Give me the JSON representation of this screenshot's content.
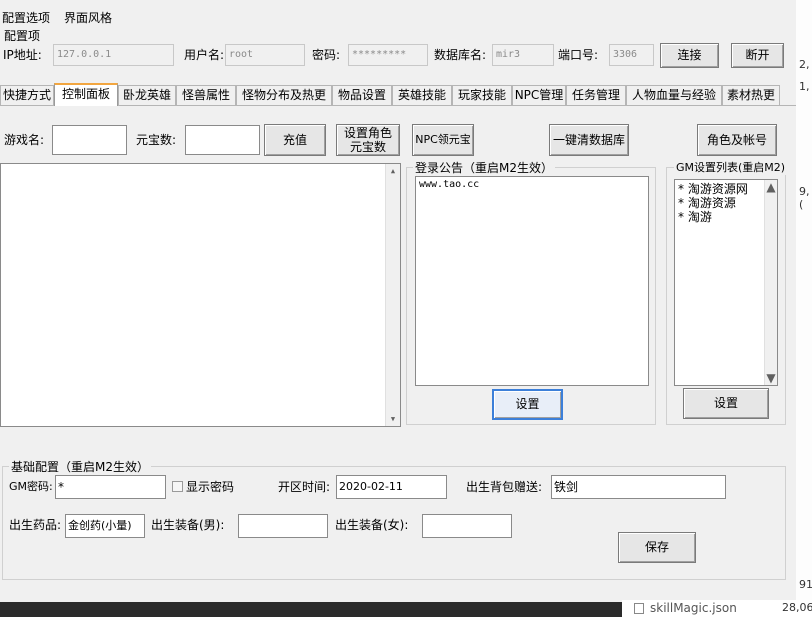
{
  "menu": {
    "config_options": "配置选项",
    "ui_style": "界面风格"
  },
  "config_section": {
    "title": "配置项",
    "ip_label": "IP地址:",
    "ip_value": "127.0.0.1",
    "user_label": "用户名:",
    "user_value": "root",
    "password_label": "密码:",
    "password_value": "*********",
    "db_label": "数据库名:",
    "db_value": "mir3",
    "port_label": "端口号:",
    "port_value": "3306",
    "connect_button": "连接",
    "disconnect_button": "断开"
  },
  "tabs": [
    {
      "label": "快捷方式",
      "active": false
    },
    {
      "label": "控制面板",
      "active": true
    },
    {
      "label": "卧龙英雄",
      "active": false
    },
    {
      "label": "怪兽属性",
      "active": false
    },
    {
      "label": "怪物分布及热更",
      "active": false
    },
    {
      "label": "物品设置",
      "active": false
    },
    {
      "label": "英雄技能",
      "active": false
    },
    {
      "label": "玩家技能",
      "active": false
    },
    {
      "label": "NPC管理",
      "active": false
    },
    {
      "label": "任务管理",
      "active": false
    },
    {
      "label": "人物血量与经验",
      "active": false
    },
    {
      "label": "素材热更",
      "active": false
    }
  ],
  "control_panel": {
    "game_name_label": "游戏名:",
    "game_name_value": "",
    "yuanbao_label": "元宝数:",
    "yuanbao_value": "",
    "recharge_button": "充值",
    "set_role_yuanbao_button": "设置角色元宝数",
    "npc_yuanbao_button": "NPC领元宝",
    "clear_db_button": "一键清数据库",
    "role_account_button": "角色及帐号"
  },
  "login_notice": {
    "title": "登录公告（重启M2生效）",
    "content": "www.tao.cc",
    "set_button": "设置"
  },
  "gm_list": {
    "title": "GM设置列表(重启M2)",
    "items": [
      "* 淘游资源网",
      "* 淘游资源",
      "* 淘游"
    ],
    "set_button": "设置"
  },
  "basic_config": {
    "title": "基础配置（重启M2生效）",
    "gm_password_label": "GM密码:",
    "gm_password_value": "*",
    "show_password_label": "显示密码",
    "open_time_label": "开区时间:",
    "open_time_value": "2020-02-11",
    "birth_bag_gift_label": "出生背包赠送:",
    "birth_bag_gift_value": "铁剑",
    "birth_potion_label": "出生药品:",
    "birth_potion_value": "金创药(小量)",
    "birth_equip_male_label": "出生装备(男):",
    "birth_equip_male_value": "",
    "birth_equip_female_label": "出生装备(女):",
    "birth_equip_female_value": "",
    "save_button": "保存"
  },
  "background": {
    "side_fragments": [
      "2,",
      "1,",
      "9,("
    ],
    "bottom_right": [
      "91",
      "28,06"
    ],
    "file_name": "skillMagic.json"
  }
}
